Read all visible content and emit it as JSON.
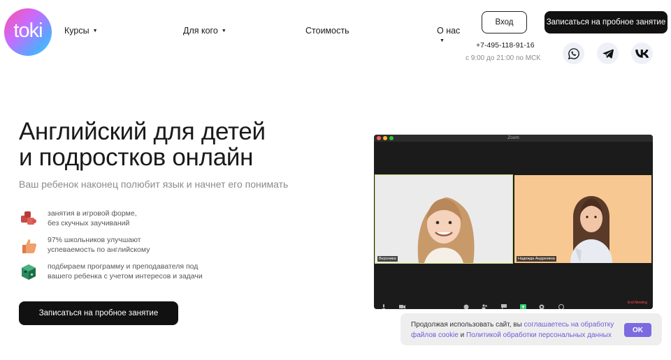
{
  "header": {
    "logo_text": "toki",
    "nav": [
      {
        "label": "Курсы"
      },
      {
        "label": "Для кого"
      },
      {
        "label": "Стоимость"
      },
      {
        "label": "О нас"
      }
    ],
    "login_label": "Вход",
    "trial_label": "Записаться на пробное занятие",
    "phone": "+7-495-118-91-16",
    "hours": "с 9:00 до 21:00 по МСК",
    "social": [
      "whatsapp-icon",
      "telegram-icon",
      "vk-icon"
    ]
  },
  "hero": {
    "title_line1": "Английский для детей",
    "title_line2": "и подростков онлайн",
    "subtitle": "Ваш ребенок наконец полюбит язык и начнет его понимать",
    "features": [
      {
        "line1": "занятия в игровой форме,",
        "line2": "без скучных заучиваний",
        "icon": "puzzle-icon"
      },
      {
        "line1": "97% школьников улучшают",
        "line2": "успеваемость по английскому",
        "icon": "thumbs-up-icon"
      },
      {
        "line1": "подбираем программу и преподавателя под",
        "line2": "вашего ребенка с учетом интересов и задачи",
        "icon": "cube-icon"
      }
    ],
    "cta_label": "Записаться на пробное занятие"
  },
  "zoom": {
    "window_title": "Zoom",
    "participants": [
      {
        "name": "Вероника"
      },
      {
        "name": "Надежда Андреевна"
      }
    ],
    "end_label": "End Meeting"
  },
  "cookie": {
    "text_before": "Продолжая использовать сайт, вы ",
    "link1": "соглашаетесь на обработку файлов cookie",
    "text_mid": " и ",
    "link2": "Политикой обработки персональных данных",
    "ok_label": "OK"
  },
  "colors": {
    "accent": "#7b6ae0",
    "dark_button": "#111111",
    "social_bg": "#eef0f8"
  }
}
